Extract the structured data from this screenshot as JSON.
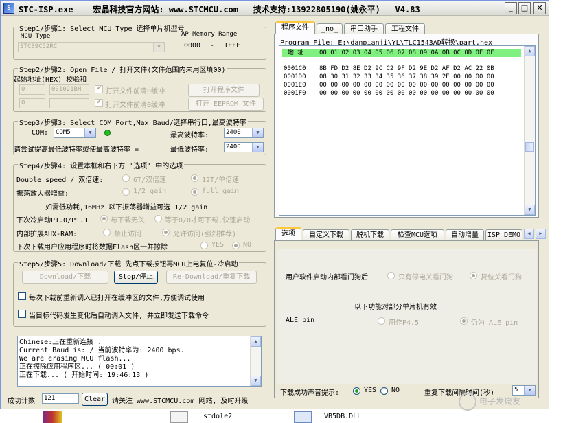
{
  "window": {
    "title": "STC-ISP.exe",
    "title_site_label": "宏晶科技官方网站:",
    "title_site": "www.STCMCU.com",
    "title_support_label": "技术支持:",
    "title_support": "13922805190(姚永平)",
    "title_version": "V4.83"
  },
  "step1": {
    "label": "Step1/步骤1: Select MCU Type  选择单片机型号",
    "mcu_type_label": "MCU Type",
    "ap_memory_label": "AP Memory Range",
    "mcu_value": "STC89C52RC",
    "range_start": "0000",
    "range_dash": "-",
    "range_end": "1FFF"
  },
  "step2": {
    "label": "Step2/步骤2: Open File / 打开文件(文件范围内未用区填00)",
    "addr_label": "起始地址(HEX) 校验和",
    "addr1": "0",
    "checksum1": "001021BH",
    "check1_label": "打开文件前清0缓冲",
    "open_prog_button": "打开程序文件",
    "addr2": "0",
    "checksum2": "",
    "check2_label": "打开文件前清0缓冲",
    "open_eeprom_button": "打开 EEPROM 文件"
  },
  "step3": {
    "label": "Step3/步骤3: Select COM Port,Max Baud/选择串行口,最高波特率",
    "com_label": "COM:",
    "com_value": "COM5",
    "max_baud_label": "最高波特率:",
    "max_baud_value": "2400",
    "hint": "请尝试提高最低波特率或使最高波特率 =",
    "min_baud_label": "最低波特率:",
    "min_baud_value": "2400"
  },
  "step4": {
    "label": "Step4/步骤4: 设置本框和右下方 '选项' 中的选项",
    "double_speed_label": "Double speed / 双倍速:",
    "opt_6t": "6T/双倍速",
    "opt_12t": "12T/单倍速",
    "osc_gain_label": "振荡放大器增益:",
    "opt_half_gain": "1/2 gain",
    "opt_full_gain": "full gain",
    "osc_note": "如需低功耗,16MHz 以下振荡器增益可选 1/2 gain",
    "cold_boot_label": "下次冷启动P1.0/P1.1",
    "opt_no_relation": "与下载无关",
    "opt_equal_zero": "等于0/0才可下载,快速启动",
    "aux_ram_label": "内部扩展AUX-RAM:",
    "opt_forbid": "禁止访问",
    "opt_allow": "允许访问(强烈推荐)",
    "erase_flash_label": "下次下载用户应用程序时将数据Flash区一并擦除",
    "opt_yes": "YES",
    "opt_no": "NO"
  },
  "step5": {
    "label": "Step5/步骤5: Download/下载  先点下载按钮再MCU上电复位-冷启动",
    "download_button": "Download/下载",
    "stop_button": "Stop/停止",
    "redownload_button": "Re-Download/重复下载",
    "check_reload": "每次下载前重新调入已打开在缓冲区的文件,方便调试使用",
    "check_auto": "当目标代码发生变化后自动调入文件, 并立即发送下载命令"
  },
  "log": {
    "lines": [
      "Chinese:正在重新连接 .",
      "Current Baud is: / 当前波特率为: 2400 bps.",
      "We are erasing MCU flash...",
      "正在擦除应用程序区... ( 00:01 )",
      "正在下载... ( 开始时间: 19:46:13 )"
    ]
  },
  "status": {
    "success_count_label": "成功计数",
    "success_count": "121",
    "clear_button": "Clear",
    "visit_text": "请关注 www.STCMCU.com 网站, 及时升级"
  },
  "top_tabs": [
    "程序文件",
    "_no_",
    "串口助手",
    "工程文件"
  ],
  "program": {
    "file_label": "Program File:",
    "file_path": "E:\\danpianji\\YL\\TLC1543AD转换\\part.hex",
    "hex_header_addr": "地 址",
    "hex_header_cols": "00 01 02 03 04 05 06 07 08 09 0A 0B 0C 0D 0E 0F",
    "hex_rows": [
      {
        "addr": "0001C0",
        "bytes": "8B FD D2 8E D2 9C C2 9F D2 9E D2 AF D2 AC 22 0B"
      },
      {
        "addr": "0001D0",
        "bytes": "08 30 31 32 33 34 35 36 37 38 39 2E 00 00 00 00"
      },
      {
        "addr": "0001E0",
        "bytes": "00 00 00 00 00 00 00 00 00 00 00 00 00 00 00 00"
      },
      {
        "addr": "0001F0",
        "bytes": "00 00 00 00 00 00 00 00 00 00 00 00 00 00 00 00"
      }
    ]
  },
  "bottom_tabs": [
    "选项",
    "自定义下载",
    "脱机下载",
    "检查MCU选项",
    "自动增量",
    "ISP DEMO"
  ],
  "options": {
    "watchdog_label": "用户软件启动内部看门狗后",
    "opt_stop_watchdog": "只有停电关看门狗",
    "opt_reset_watchdog": "复位关看门狗",
    "valid_note": "以下功能对部分单片机有效",
    "ale_label": "ALE pin",
    "opt_ale_p45": "用作P4.5",
    "opt_ale_pin": "仍为 ALE pin",
    "sound_label": "下载成功声音提示:",
    "sound_yes": "YES",
    "sound_no": "NO",
    "interval_label": "重复下载间隔时间(秒)",
    "interval_value": "5"
  },
  "taskbar": {
    "item1": "stdole2",
    "item2": "VB5DB.DLL"
  },
  "watermark": {
    "text": "电子发烧友"
  }
}
